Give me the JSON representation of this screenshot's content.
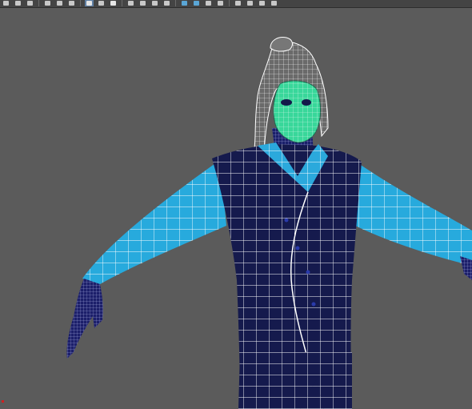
{
  "toolbar": {
    "buttons": [
      {
        "icon": "select-icon",
        "active": false
      },
      {
        "icon": "lasso-icon",
        "active": false
      },
      {
        "icon": "paint-select-icon",
        "active": false
      },
      {
        "icon": "translate-icon",
        "active": false
      },
      {
        "icon": "rotate-icon",
        "active": false
      },
      {
        "icon": "scale-icon",
        "active": false
      },
      {
        "icon": "wireframe-icon",
        "active": true
      },
      {
        "icon": "smooth-shade-icon",
        "active": false
      },
      {
        "icon": "textured-icon",
        "active": false
      },
      {
        "icon": "lighting-icon",
        "active": false
      },
      {
        "icon": "shadows-icon",
        "active": false
      },
      {
        "icon": "camera-icon",
        "active": false
      },
      {
        "icon": "isolate-icon",
        "active": false
      },
      {
        "icon": "xray-icon",
        "active": false
      },
      {
        "icon": "grid-icon",
        "active": false
      },
      {
        "icon": "film-gate-icon",
        "active": false
      },
      {
        "icon": "resolution-gate-icon",
        "active": false
      },
      {
        "icon": "safe-area-icon",
        "active": false
      }
    ]
  },
  "viewport": {
    "background": "#5b5b5b",
    "wireframe_color": "#ffffff",
    "colors": {
      "body_dark": "#151a4d",
      "sleeve_cyan": "#27aadd",
      "collar_cyan": "#2ba9dc",
      "face_green": "#38d79a",
      "hand_dark": "#1c1f6a"
    }
  }
}
